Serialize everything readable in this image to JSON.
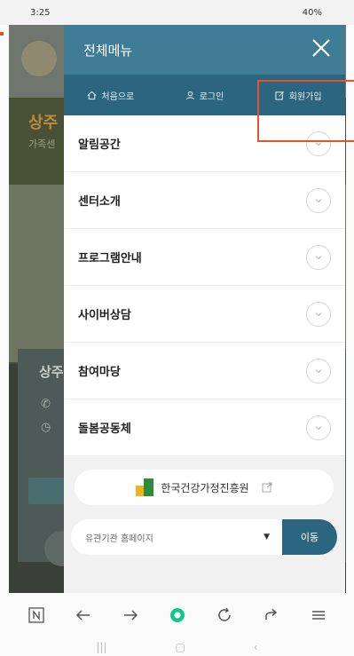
{
  "status_bar": {
    "time": "3:25",
    "battery": "40%"
  },
  "drawer": {
    "title": "전체메뉴",
    "nav": [
      {
        "label": "처음으로",
        "icon": "home-icon"
      },
      {
        "label": "로그인",
        "icon": "user-icon"
      },
      {
        "label": "회원가입",
        "icon": "edit-icon"
      }
    ],
    "menu": [
      {
        "label": "알림공간"
      },
      {
        "label": "센터소개"
      },
      {
        "label": "프로그램안내"
      },
      {
        "label": "사이버상담"
      },
      {
        "label": "참여마당"
      },
      {
        "label": "돌봄공동체"
      }
    ],
    "site_link": {
      "label": "한국건강가정진흥원"
    },
    "related_sites": {
      "selected": "유관기관 홈페이지"
    },
    "go_button": "이동"
  },
  "background_page": {
    "banner_title": "상주",
    "banner_sub": "가족센",
    "card_title": "상주"
  },
  "colors": {
    "drawer_header": "#3f7d96",
    "drawer_nav": "#2c6580",
    "highlight": "#e5532b",
    "go_button": "#2c6580"
  }
}
